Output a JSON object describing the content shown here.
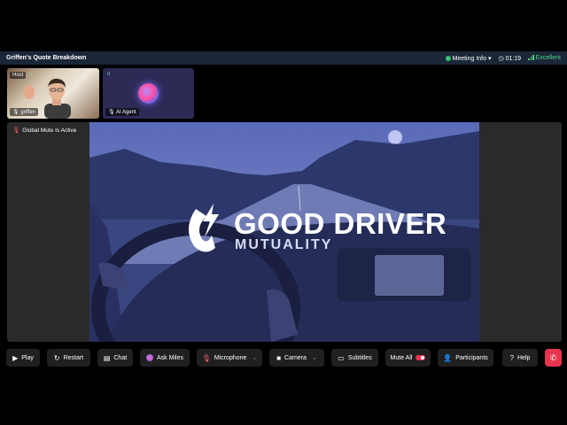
{
  "meeting": {
    "title": "Griffen's Quote Breakdown",
    "info_label": "Meeting Info",
    "timer": "01:19",
    "quality": "Excellent"
  },
  "participants": [
    {
      "name": "griffen",
      "role_tag": "Host"
    },
    {
      "name": "AI Agent"
    }
  ],
  "stage": {
    "mute_notice": "Global Mute Is Active",
    "slide_logo_line1": "GOOD DRIVER",
    "slide_logo_line2": "MUTUALITY"
  },
  "toolbar": {
    "play": "Play",
    "restart": "Restart",
    "chat": "Chat",
    "ask_miles": "Ask Miles",
    "microphone": "Microphone",
    "camera": "Camera",
    "subtitles": "Subtitles",
    "mute_all": "Mute All",
    "participants": "Participants",
    "help": "Help"
  },
  "colors": {
    "accent_red": "#e8344f",
    "quality_green": "#4cd27c",
    "slide_tint": "#3a4aa6"
  },
  "icons": {
    "play": "play-circle-icon",
    "restart": "restart-icon",
    "chat": "chat-bubble-icon",
    "microphone": "microphone-muted-icon",
    "camera": "video-camera-icon",
    "subtitles": "subtitles-icon",
    "participants": "participants-icon",
    "help": "help-icon",
    "end": "end-call-icon"
  }
}
